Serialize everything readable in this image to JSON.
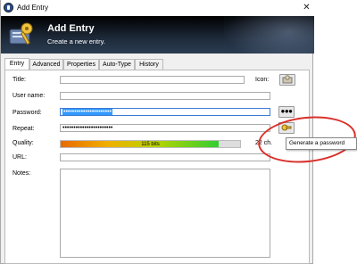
{
  "window": {
    "title": "Add Entry",
    "close_glyph": "✕"
  },
  "banner": {
    "title": "Add Entry",
    "subtitle": "Create a new entry."
  },
  "tabs": [
    {
      "label": "Entry",
      "active": true
    },
    {
      "label": "Advanced",
      "active": false
    },
    {
      "label": "Properties",
      "active": false
    },
    {
      "label": "Auto-Type",
      "active": false
    },
    {
      "label": "History",
      "active": false
    }
  ],
  "form": {
    "title_label": "Title:",
    "title_value": "",
    "icon_label": "Icon:",
    "username_label": "User name:",
    "username_value": "",
    "password_label": "Password:",
    "password_value": "••••••••••••••••••••••",
    "show_password_glyph": "●●●",
    "repeat_label": "Repeat:",
    "repeat_value": "•••••••••••••••••••••••",
    "quality_label": "Quality:",
    "quality_text": "115 bits",
    "quality_fraction": 0.88,
    "quality_chars": "22 ch.",
    "url_label": "URL:",
    "url_value": "",
    "notes_label": "Notes:",
    "notes_value": ""
  },
  "tooltip": {
    "text": "Generate a password"
  },
  "colors": {
    "annotation_circle": "#d9302a",
    "selection": "#3399ff",
    "banner_bg": "#1e2a3a"
  },
  "icons": [
    "app-keepass-icon",
    "key-icon",
    "entry-icon",
    "generate-password-icon"
  ]
}
